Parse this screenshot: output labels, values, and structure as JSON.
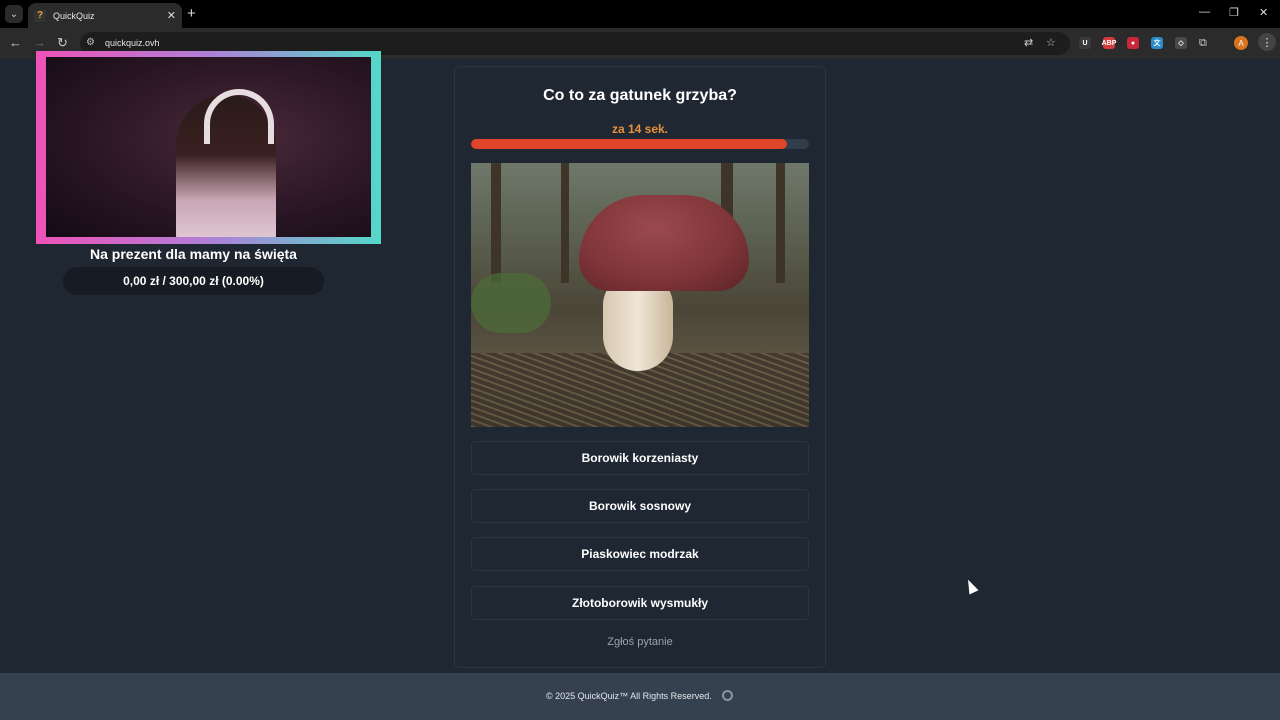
{
  "browser": {
    "tab_title": "QuickQuiz",
    "favicon": "?",
    "tab_close": "✕",
    "new_tab": "+",
    "url": "quickquiz.ovh",
    "profile_initial": "A",
    "extensions": [
      {
        "name": "extension-u",
        "label": "U",
        "color": "#3a3a3a"
      },
      {
        "name": "extension-adblock",
        "label": "ABP",
        "color": "#d33c3c"
      },
      {
        "name": "extension-red",
        "label": "●",
        "color": "#c8283a"
      },
      {
        "name": "extension-translate",
        "label": "文",
        "color": "#2a8cc8"
      },
      {
        "name": "extension-grey",
        "label": "◇",
        "color": "#4a4a4a"
      }
    ]
  },
  "stream_overlay": {
    "goal_label": "Na prezent dla mamy na święta",
    "goal_progress": "0,00 zł / 300,00 zł (0.00%)",
    "goal_fraction": 0.0
  },
  "quiz": {
    "question": "Co to za gatunek grzyba?",
    "timer_text": "za 14 sek.",
    "timer_fraction": 0.935,
    "answers": [
      "Borowik korzeniasty",
      "Borowik sosnowy",
      "Piaskowiec modrzak",
      "Złotoborowik wysmukły"
    ],
    "report_label": "Zgłoś pytanie"
  },
  "footer": {
    "copyright": "© 2025  QuickQuiz™ All Rights Reserved."
  },
  "colors": {
    "background": "#1f2733",
    "timer_text": "#e8903c",
    "timer_bar": "#e0452a",
    "footer": "#364150"
  }
}
